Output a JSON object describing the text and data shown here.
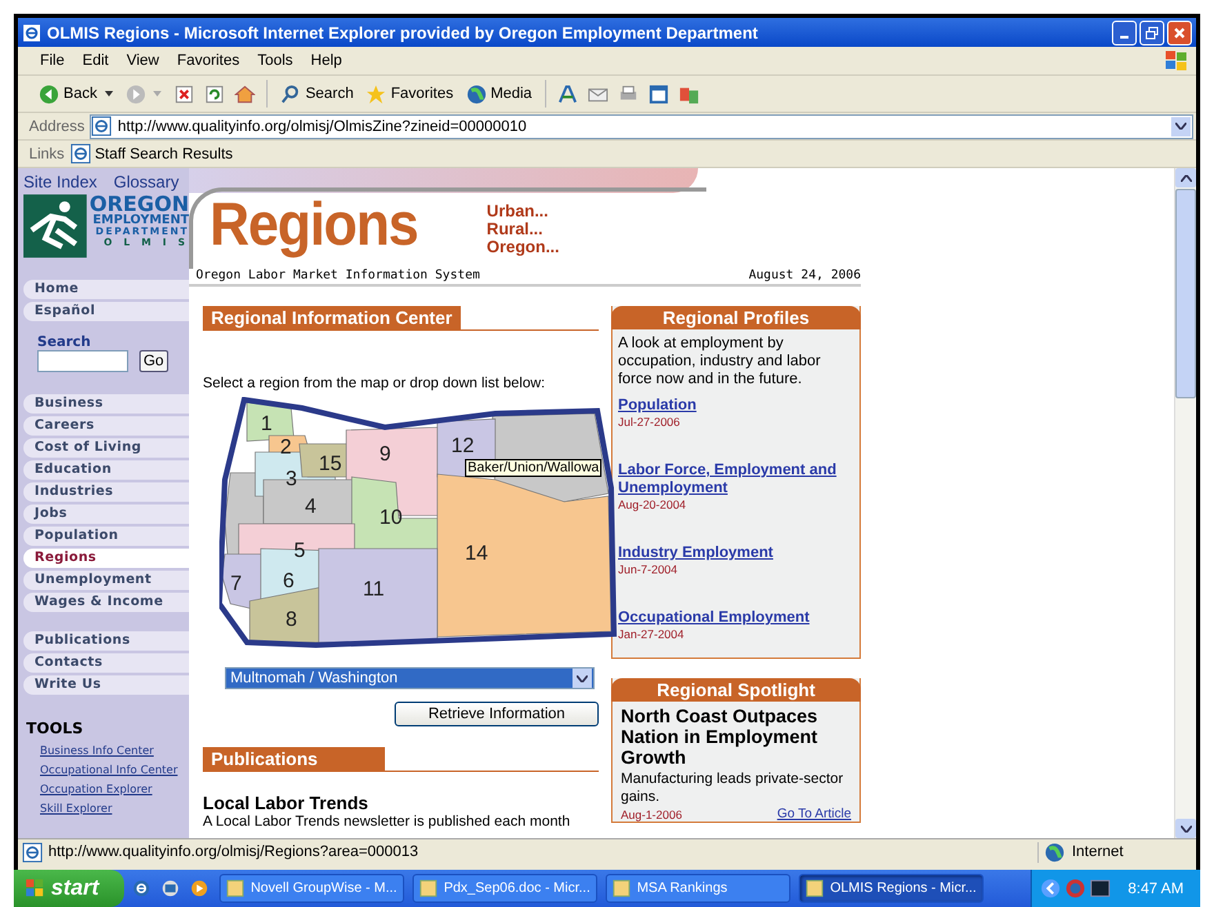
{
  "window": {
    "title": "OLMIS Regions - Microsoft Internet Explorer provided by Oregon Employment Department"
  },
  "menu_bar": [
    "File",
    "Edit",
    "View",
    "Favorites",
    "Tools",
    "Help"
  ],
  "toolbar": {
    "back": "Back",
    "search": "Search",
    "favorites": "Favorites",
    "media": "Media"
  },
  "address_bar": {
    "label": "Address",
    "url": "http://www.qualityinfo.org/olmisj/OlmisZine?zineid=00000010"
  },
  "links_bar": {
    "label": "Links",
    "items": [
      "Staff Search Results"
    ]
  },
  "page": {
    "top_links": [
      "Site Index",
      "Glossary"
    ],
    "logo": {
      "name": "OREGON",
      "line2": "EMPLOYMENT",
      "line3": "DEPARTMENT",
      "line4": "O L M I S"
    },
    "header": {
      "title": "Regions",
      "taglines": [
        "Urban...",
        "Rural...",
        "Oregon..."
      ],
      "subtitle": "Oregon Labor Market Information System",
      "date": "August 24, 2006"
    },
    "nav": [
      {
        "items": [
          {
            "label": "Home",
            "selected": false
          },
          {
            "label": "Español",
            "selected": false
          }
        ]
      },
      {
        "items": [
          {
            "label": "Business",
            "selected": false
          },
          {
            "label": "Careers",
            "selected": false
          },
          {
            "label": "Cost of Living",
            "selected": false
          },
          {
            "label": "Education",
            "selected": false
          },
          {
            "label": "Industries",
            "selected": false
          },
          {
            "label": "Jobs",
            "selected": false
          },
          {
            "label": "Population",
            "selected": false
          },
          {
            "label": "Regions",
            "selected": true
          },
          {
            "label": "Unemployment",
            "selected": false
          },
          {
            "label": "Wages & Income",
            "selected": false
          }
        ]
      },
      {
        "items": [
          {
            "label": "Publications",
            "selected": false
          },
          {
            "label": "Contacts",
            "selected": false
          },
          {
            "label": "Write Us",
            "selected": false
          }
        ]
      }
    ],
    "search": {
      "label": "Search",
      "button": "Go"
    },
    "tools": {
      "heading": "TOOLS",
      "links": [
        "Business Info Center",
        "Occupational Info Center",
        "Occupation Explorer",
        "Skill Explorer"
      ]
    },
    "info_center": {
      "heading": "Regional Information Center",
      "instruction": "Select a region from the map or drop down list below:",
      "map_regions": [
        {
          "label": "1",
          "color": "#c6e3b4"
        },
        {
          "label": "2",
          "color": "#f7c68f"
        },
        {
          "label": "3",
          "color": "#cfe9ef"
        },
        {
          "label": "15",
          "color": "#c8c49a"
        },
        {
          "label": "9",
          "color": "#f4cfd6"
        },
        {
          "label": "12",
          "color": "#c9c6e4"
        },
        {
          "label": "4",
          "color": "#c8c8c8"
        },
        {
          "label": "10",
          "color": "#c6e3b4"
        },
        {
          "label": "5",
          "color": "#f4cfd6"
        },
        {
          "label": "14",
          "color": "#f7c68f"
        },
        {
          "label": "7",
          "color": "#c9c6e4"
        },
        {
          "label": "6",
          "color": "#cfe9ef"
        },
        {
          "label": "8",
          "color": "#c8c49a"
        },
        {
          "label": "11",
          "color": "#c9c6e4"
        }
      ],
      "tooltip": "Baker/Union/Wallowa",
      "region_select": "Multnomah / Washington",
      "button": "Retrieve Information"
    },
    "publications": {
      "heading": "Publications",
      "title": "Local Labor Trends",
      "text": "A Local Labor Trends newsletter is published each month"
    },
    "profiles": {
      "heading": "Regional Profiles",
      "intro": "A look at employment by occupation, industry and labor force now and in the future.",
      "links": [
        {
          "title": "Population",
          "date": "Jul-27-2006"
        },
        {
          "title": "Labor Force, Employment and Unemployment",
          "date": "Aug-20-2004"
        },
        {
          "title": "Industry Employment",
          "date": "Jun-7-2004"
        },
        {
          "title": "Occupational Employment",
          "date": "Jan-27-2004"
        }
      ]
    },
    "spotlight": {
      "heading": "Regional Spotlight",
      "headline": "North Coast Outpaces Nation in Employment Growth",
      "summary": "Manufacturing leads private-sector gains.",
      "date": "Aug-1-2006",
      "link": "Go To Article"
    }
  },
  "status_bar": {
    "url": "http://www.qualityinfo.org/olmisj/Regions?area=000013",
    "zone": "Internet"
  },
  "taskbar": {
    "start": "start",
    "tasks": [
      {
        "label": "Novell GroupWise - M...",
        "selected": false
      },
      {
        "label": "Pdx_Sep06.doc - Micr...",
        "selected": false
      },
      {
        "label": "MSA Rankings",
        "selected": false
      },
      {
        "label": "OLMIS Regions - Micr...",
        "selected": true
      }
    ],
    "time": "8:47 AM"
  }
}
